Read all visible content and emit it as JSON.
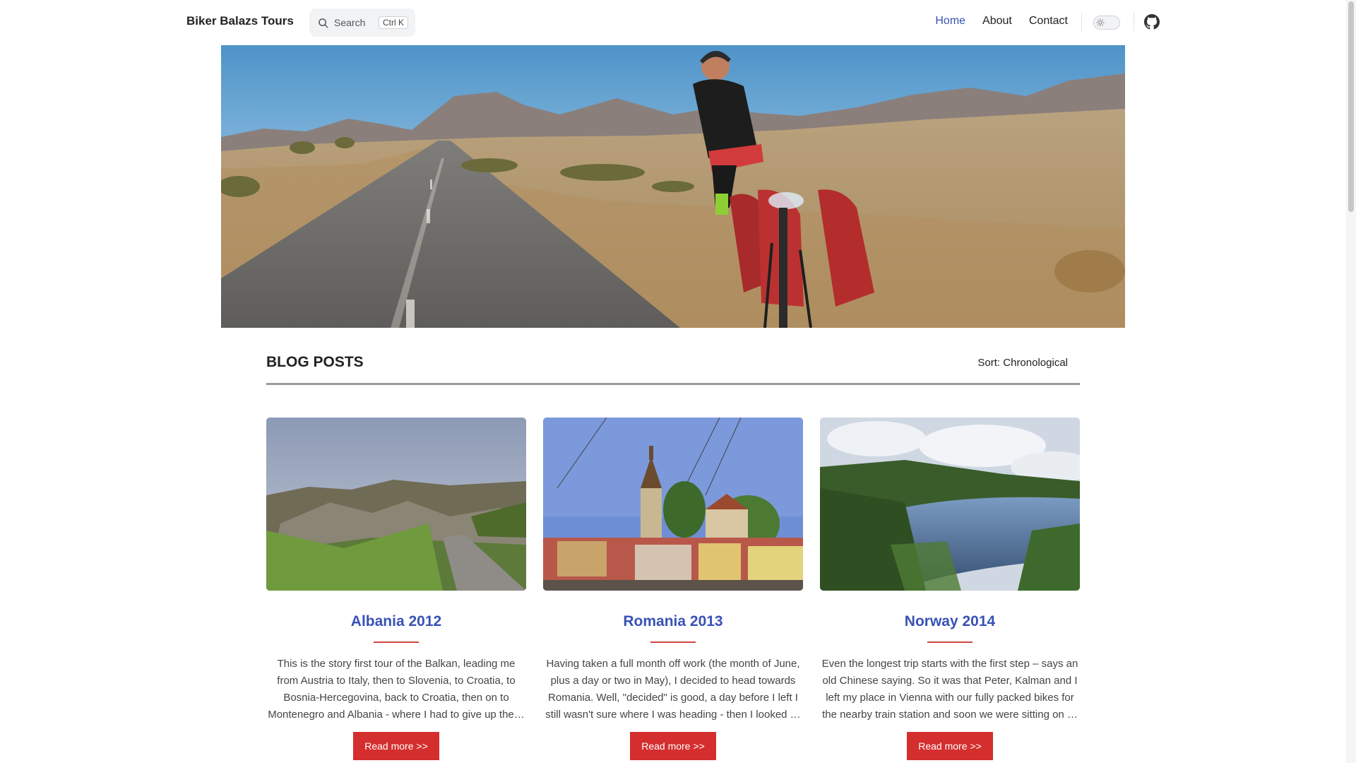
{
  "site": {
    "brand": "Biker Balazs Tours"
  },
  "search": {
    "label": "Search",
    "shortcut": "Ctrl K",
    "icon": "search-icon"
  },
  "nav": {
    "links": [
      {
        "label": "Home",
        "active": true
      },
      {
        "label": "About",
        "active": false
      },
      {
        "label": "Contact",
        "active": false
      }
    ],
    "theme_toggle_icon": "sun-icon",
    "github_icon": "github-icon"
  },
  "blog": {
    "heading": "BLOG POSTS",
    "sort_label": "Sort: Chronological",
    "posts": [
      {
        "title": "Albania 2012",
        "excerpt": "This is the story first tour of the Balkan, leading me from Austria to Italy, then to Slovenia, to Croatia, to Bosnia-Hercegovina, back to Croatia, then on to Montenegro and Albania - where I had to give up the…",
        "read_more": "Read more >>"
      },
      {
        "title": "Romania 2013",
        "excerpt": "Having taken a full month off work (the month of June, plus a day or two in May), I decided to head towards Romania. Well, \"decided\" is good, a day before I left I still wasn't sure where I was heading - then I looked …",
        "read_more": "Read more >>"
      },
      {
        "title": "Norway 2014",
        "excerpt": "Even the longest trip starts with the first step – says an old Chinese saying. So it was that Peter, Kalman and I left my place in Vienna with our fully packed bikes for the nearby train station and soon we were sitting on …",
        "read_more": "Read more >>"
      }
    ]
  },
  "colors": {
    "accent_link": "#3852b6",
    "button": "#d42e2e",
    "title_rule": "#d0453f"
  }
}
